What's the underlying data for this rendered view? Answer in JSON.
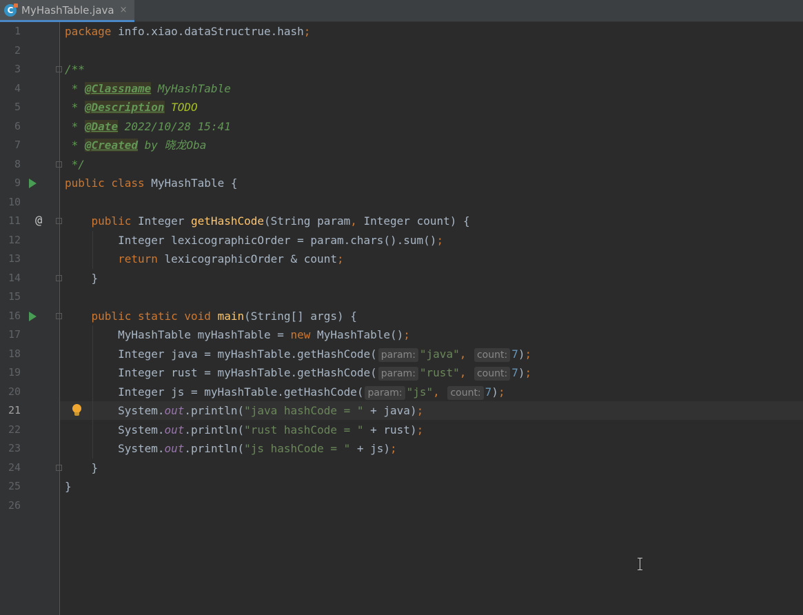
{
  "tab": {
    "title": "MyHashTable.java",
    "close": "×",
    "icon": "java-class-icon"
  },
  "colors": {
    "background": "#2b2b2b",
    "keyword": "#cc7832",
    "string": "#6a8759",
    "number": "#6897bb",
    "method": "#ffc66d",
    "doc": "#629755"
  },
  "editor": {
    "current_line": 21,
    "lines": [
      {
        "n": "1",
        "tokens": [
          {
            "t": "package",
            "c": "kw"
          },
          {
            "t": " info.xiao.dataStructrue.hash"
          },
          {
            "t": ";",
            "c": "kw"
          }
        ]
      },
      {
        "n": "2",
        "tokens": []
      },
      {
        "n": "3",
        "tokens": [
          {
            "t": "/**",
            "c": "doc"
          }
        ]
      },
      {
        "n": "4",
        "tokens": [
          {
            "t": " * ",
            "c": "doc"
          },
          {
            "t": "@Classname",
            "c": "tag"
          },
          {
            "t": " MyHashTable",
            "c": "doc"
          }
        ]
      },
      {
        "n": "5",
        "tokens": [
          {
            "t": " * ",
            "c": "doc"
          },
          {
            "t": "@Description",
            "c": "tag"
          },
          {
            "t": " TODO",
            "c": "todo"
          }
        ]
      },
      {
        "n": "6",
        "tokens": [
          {
            "t": " * ",
            "c": "doc"
          },
          {
            "t": "@Date",
            "c": "tag"
          },
          {
            "t": " 2022/10/28 15:41",
            "c": "doc"
          }
        ]
      },
      {
        "n": "7",
        "tokens": [
          {
            "t": " * ",
            "c": "doc"
          },
          {
            "t": "@Created",
            "c": "tag"
          },
          {
            "t": " by 晓龙Oba",
            "c": "doc"
          }
        ]
      },
      {
        "n": "8",
        "tokens": [
          {
            "t": " */",
            "c": "doc"
          }
        ]
      },
      {
        "n": "9",
        "tokens": [
          {
            "t": "public class ",
            "c": "kw"
          },
          {
            "t": "MyHashTable {"
          }
        ]
      },
      {
        "n": "10",
        "tokens": []
      },
      {
        "n": "11",
        "tokens": [
          {
            "t": "    "
          },
          {
            "t": "public ",
            "c": "kw"
          },
          {
            "t": "Integer "
          },
          {
            "t": "getHashCode",
            "c": "fn"
          },
          {
            "t": "(String param"
          },
          {
            "t": ", ",
            "c": "kw"
          },
          {
            "t": "Integer count) {"
          }
        ]
      },
      {
        "n": "12",
        "tokens": [
          {
            "t": "        Integer lexicographicOrder = param.chars().sum()"
          },
          {
            "t": ";",
            "c": "kw"
          }
        ]
      },
      {
        "n": "13",
        "tokens": [
          {
            "t": "        "
          },
          {
            "t": "return ",
            "c": "kw"
          },
          {
            "t": "lexicographicOrder & count"
          },
          {
            "t": ";",
            "c": "kw"
          }
        ]
      },
      {
        "n": "14",
        "tokens": [
          {
            "t": "    }"
          }
        ]
      },
      {
        "n": "15",
        "tokens": []
      },
      {
        "n": "16",
        "tokens": [
          {
            "t": "    "
          },
          {
            "t": "public static void ",
            "c": "kw"
          },
          {
            "t": "main",
            "c": "fn"
          },
          {
            "t": "(String[] args) {"
          }
        ]
      },
      {
        "n": "17",
        "tokens": [
          {
            "t": "        MyHashTable myHashTable = "
          },
          {
            "t": "new ",
            "c": "kw"
          },
          {
            "t": "MyHashTable()"
          },
          {
            "t": ";",
            "c": "kw"
          }
        ]
      },
      {
        "n": "18",
        "tokens": [
          {
            "t": "        Integer java = myHashTable.getHashCode("
          },
          {
            "t": "param:",
            "c": "hint"
          },
          {
            "t": "\"java\"",
            "c": "str"
          },
          {
            "t": ", ",
            "c": "kw"
          },
          {
            "t": "count:",
            "c": "hint"
          },
          {
            "t": "7",
            "c": "num"
          },
          {
            "t": ")"
          },
          {
            "t": ";",
            "c": "kw"
          }
        ]
      },
      {
        "n": "19",
        "tokens": [
          {
            "t": "        Integer rust = myHashTable.getHashCode("
          },
          {
            "t": "param:",
            "c": "hint"
          },
          {
            "t": "\"rust\"",
            "c": "str"
          },
          {
            "t": ", ",
            "c": "kw"
          },
          {
            "t": "count:",
            "c": "hint"
          },
          {
            "t": "7",
            "c": "num"
          },
          {
            "t": ")"
          },
          {
            "t": ";",
            "c": "kw"
          }
        ]
      },
      {
        "n": "20",
        "tokens": [
          {
            "t": "        Integer js = myHashTable.getHashCode("
          },
          {
            "t": "param:",
            "c": "hint"
          },
          {
            "t": "\"js\"",
            "c": "str"
          },
          {
            "t": ", ",
            "c": "kw"
          },
          {
            "t": "count:",
            "c": "hint"
          },
          {
            "t": "7",
            "c": "num"
          },
          {
            "t": ")"
          },
          {
            "t": ";",
            "c": "kw"
          }
        ]
      },
      {
        "n": "21",
        "tokens": [
          {
            "t": "        System."
          },
          {
            "t": "out",
            "c": "fld"
          },
          {
            "t": ".println("
          },
          {
            "t": "\"java hashCode = \" ",
            "c": "str"
          },
          {
            "t": "+ java)"
          },
          {
            "t": ";",
            "c": "kw"
          }
        ]
      },
      {
        "n": "22",
        "tokens": [
          {
            "t": "        System."
          },
          {
            "t": "out",
            "c": "fld"
          },
          {
            "t": ".println("
          },
          {
            "t": "\"rust hashCode = \" ",
            "c": "str"
          },
          {
            "t": "+ rust)"
          },
          {
            "t": ";",
            "c": "kw"
          }
        ]
      },
      {
        "n": "23",
        "tokens": [
          {
            "t": "        System."
          },
          {
            "t": "out",
            "c": "fld"
          },
          {
            "t": ".println("
          },
          {
            "t": "\"js hashCode = \" ",
            "c": "str"
          },
          {
            "t": "+ js)"
          },
          {
            "t": ";",
            "c": "kw"
          }
        ]
      },
      {
        "n": "24",
        "tokens": [
          {
            "t": "    }"
          }
        ]
      },
      {
        "n": "25",
        "tokens": [
          {
            "t": "}"
          }
        ]
      },
      {
        "n": "26",
        "tokens": []
      }
    ]
  },
  "gutter": {
    "run_icon_lines": [
      9,
      16
    ],
    "override_icon": "@",
    "override_line": 11,
    "fold_lines": [
      3,
      8,
      11,
      14,
      16,
      24
    ],
    "intention_bulb_line": 21
  }
}
